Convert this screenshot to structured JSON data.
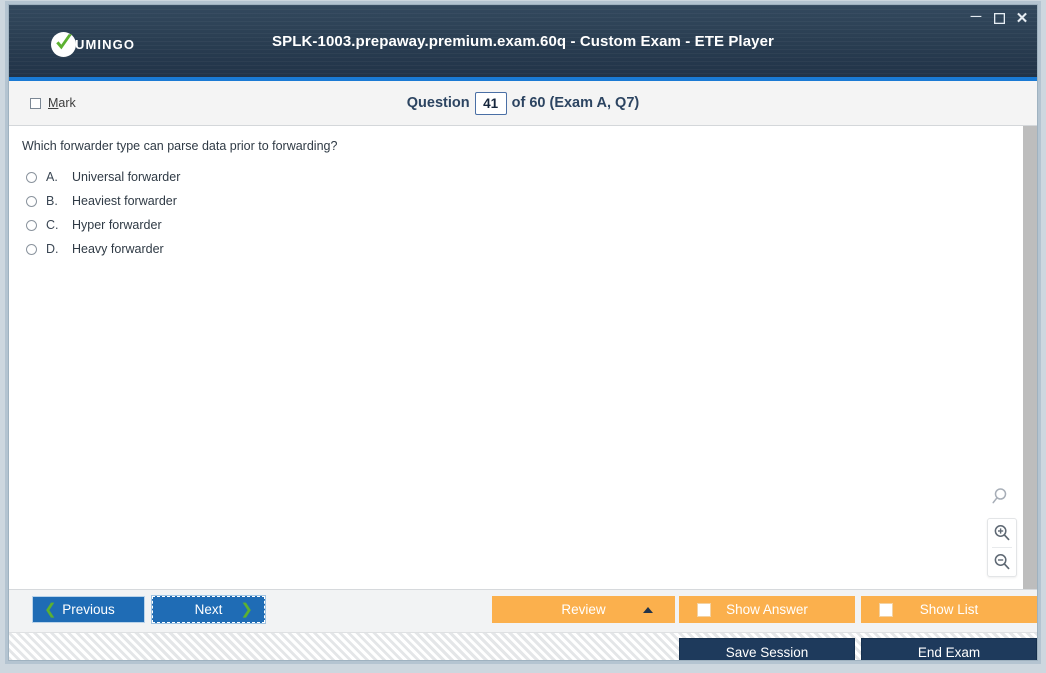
{
  "window": {
    "title": "SPLK-1003.prepaway.premium.exam.60q - Custom Exam - ETE Player",
    "controls": {
      "minimize": "minimize-icon",
      "maximize": "maximize-icon",
      "close": "close-icon"
    },
    "logo": {
      "wordmark": "UMINGO",
      "icon": "vumingo-check-icon"
    }
  },
  "question_bar": {
    "mark_label_prefix": "M",
    "mark_label_rest": "ark",
    "mark_checked": false,
    "prefix": "Question",
    "number": "41",
    "suffix": "of 60 (Exam A, Q7)"
  },
  "question": {
    "text": "Which forwarder type can parse data prior to forwarding?",
    "choices": [
      {
        "letter": "A.",
        "text": "Universal forwarder",
        "selected": false
      },
      {
        "letter": "B.",
        "text": "Heaviest forwarder",
        "selected": false
      },
      {
        "letter": "C.",
        "text": "Hyper forwarder",
        "selected": false
      },
      {
        "letter": "D.",
        "text": "Heavy forwarder",
        "selected": false
      }
    ]
  },
  "zoom_tools": {
    "search": "search-icon",
    "zoom_in": "zoom-in-icon",
    "zoom_out": "zoom-out-icon"
  },
  "toolbar": {
    "previous_label": "Previous",
    "next_label": "Next",
    "review_label": "Review",
    "show_answer_label": "Show Answer",
    "show_list_label": "Show List",
    "show_answer_checked": false,
    "show_list_checked": false
  },
  "statusbar": {
    "save_session_label": "Save Session",
    "end_exam_label": "End Exam"
  },
  "underflow": {
    "text": ""
  },
  "colors": {
    "titlebar_top": "#33495e",
    "titlebar_bottom": "#213348",
    "accent_blue": "#1a7ad4",
    "nav_button_blue": "#1f6cb5",
    "chevron_green": "#5cb130",
    "orange": "#fbb04d",
    "dark_navy": "#1e3a5c",
    "content_bg": "#ffffff",
    "toolbar_bg": "#f2f3f4"
  }
}
